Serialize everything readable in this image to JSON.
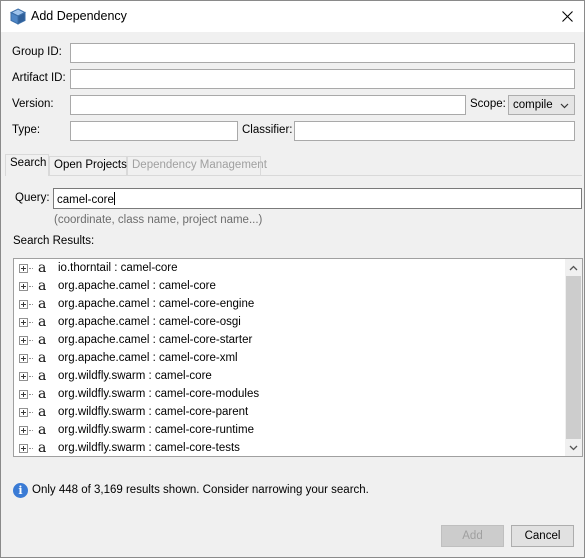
{
  "window": {
    "title": "Add Dependency",
    "close_icon": "close-icon",
    "app_icon": "app-cube-icon"
  },
  "form": {
    "group_id_label": "Group ID:",
    "group_id_value": "",
    "artifact_id_label": "Artifact ID:",
    "artifact_id_value": "",
    "version_label": "Version:",
    "version_value": "",
    "scope_label": "Scope:",
    "scope_value": "compile",
    "type_label": "Type:",
    "type_value": "",
    "classifier_label": "Classifier:",
    "classifier_value": ""
  },
  "tabs": [
    {
      "label": "Search",
      "active": true,
      "enabled": true
    },
    {
      "label": "Open Projects",
      "active": false,
      "enabled": true
    },
    {
      "label": "Dependency Management",
      "active": false,
      "enabled": false
    }
  ],
  "search": {
    "query_label": "Query:",
    "query_value": "camel-core",
    "hint": "(coordinate, class name, project name...)",
    "results_label": "Search Results:"
  },
  "results": [
    "io.thorntail : camel-core",
    "org.apache.camel : camel-core",
    "org.apache.camel : camel-core-engine",
    "org.apache.camel : camel-core-osgi",
    "org.apache.camel : camel-core-starter",
    "org.apache.camel : camel-core-xml",
    "org.wildfly.swarm : camel-core",
    "org.wildfly.swarm : camel-core-modules",
    "org.wildfly.swarm : camel-core-parent",
    "org.wildfly.swarm : camel-core-runtime",
    "org.wildfly.swarm : camel-core-tests"
  ],
  "result_icon_glyph": "a",
  "info": {
    "icon": "info-icon",
    "text": "Only 448 of 3,169 results shown. Consider narrowing your search."
  },
  "buttons": {
    "add": "Add",
    "cancel": "Cancel"
  },
  "colors": {
    "accent": "#3a7bd5",
    "disabled_text": "#a0a0a0"
  }
}
